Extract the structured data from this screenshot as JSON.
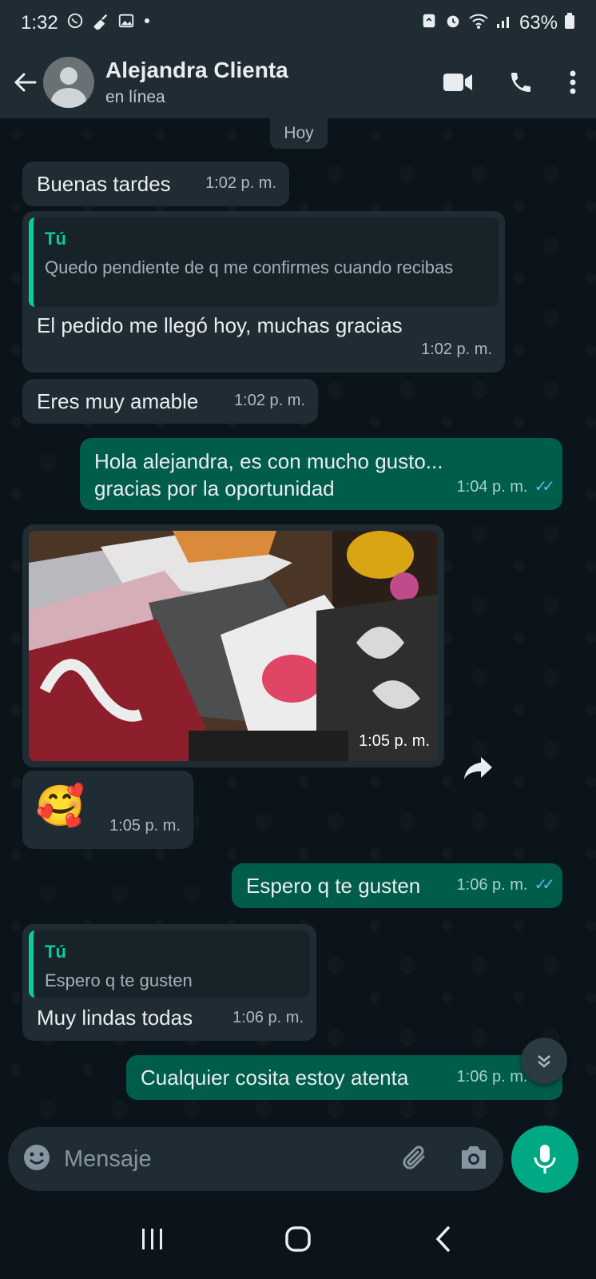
{
  "status_bar": {
    "time": "1:32",
    "battery": "63%",
    "left_icons": [
      "whatsapp-icon",
      "broom-icon",
      "gallery-icon",
      "dot-icon"
    ],
    "right_icons": [
      "recycle-icon",
      "alarm-icon",
      "wifi-icon",
      "signal-icon",
      "battery-icon"
    ]
  },
  "header": {
    "contact_name": "Alejandra Clienta",
    "contact_status": "en línea",
    "icons": [
      "back-arrow-icon",
      "avatar-icon",
      "video-call-icon",
      "phone-icon",
      "more-vert-icon"
    ]
  },
  "chat": {
    "date_chip": "Hoy",
    "messages": [
      {
        "direction": "in",
        "text": "Buenas tardes",
        "time": "1:02 p. m."
      },
      {
        "direction": "in",
        "quote_author": "Tú",
        "quote_text": "Quedo pendiente de q me confirmes cuando recibas",
        "text": "El pedido me llegó hoy, muchas gracias",
        "time": "1:02 p. m."
      },
      {
        "direction": "in",
        "text": "Eres muy amable",
        "time": "1:02 p. m."
      },
      {
        "direction": "out",
        "text": "Hola alejandra, es con mucho gusto... gracias por la oportunidad",
        "time": "1:04 p. m.",
        "ticks": "✓✓"
      },
      {
        "direction": "in",
        "type": "image",
        "time": "1:05 p. m."
      },
      {
        "direction": "in",
        "type": "emoji",
        "emoji": "🥰",
        "time": "1:05 p. m."
      },
      {
        "direction": "out",
        "text": "Espero q te gusten",
        "time": "1:06 p. m.",
        "ticks": "✓✓"
      },
      {
        "direction": "in",
        "quote_author": "Tú",
        "quote_text": "Espero q te gusten",
        "text": "Muy lindas todas",
        "time": "1:06 p. m."
      },
      {
        "direction": "out",
        "text": "Cualquier cosita estoy atenta",
        "time": "1:06 p. m.",
        "ticks": "✓✓"
      }
    ]
  },
  "composer": {
    "placeholder": "Mensaje",
    "icons": [
      "emoji-icon",
      "attach-icon",
      "camera-icon",
      "mic-icon"
    ]
  },
  "nav_icons": [
    "recent-apps-icon",
    "home-icon",
    "back-icon"
  ],
  "colors": {
    "incoming_bubble": "#1f2c34",
    "outgoing_bubble": "#005c4b",
    "accent": "#00a884",
    "read_ticks": "#53bdeb"
  }
}
